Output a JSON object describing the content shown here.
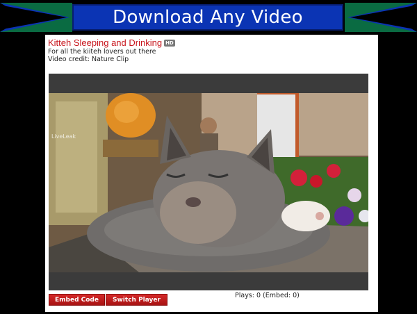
{
  "banner": {
    "title": "Download Any Video"
  },
  "video": {
    "title": "Kitteh Sleeping and Drinking",
    "hd_badge": "HD",
    "description": "For all the kiiteh lovers out there",
    "credit": "Video credit: Nature Clip",
    "watermark": "LiveLeak",
    "thumbnail_icon": "sleeping-cat-video-frame"
  },
  "controls": {
    "embed_label": "Embed Code",
    "switch_label": "Switch Player"
  },
  "stats": {
    "plays_text": "Plays: 0 (Embed: 0)"
  },
  "colors": {
    "banner_blue": "#0b34b4",
    "banner_accent": "#0a7a4a",
    "title_red": "#c8161d",
    "button_red": "#c01a1a"
  }
}
